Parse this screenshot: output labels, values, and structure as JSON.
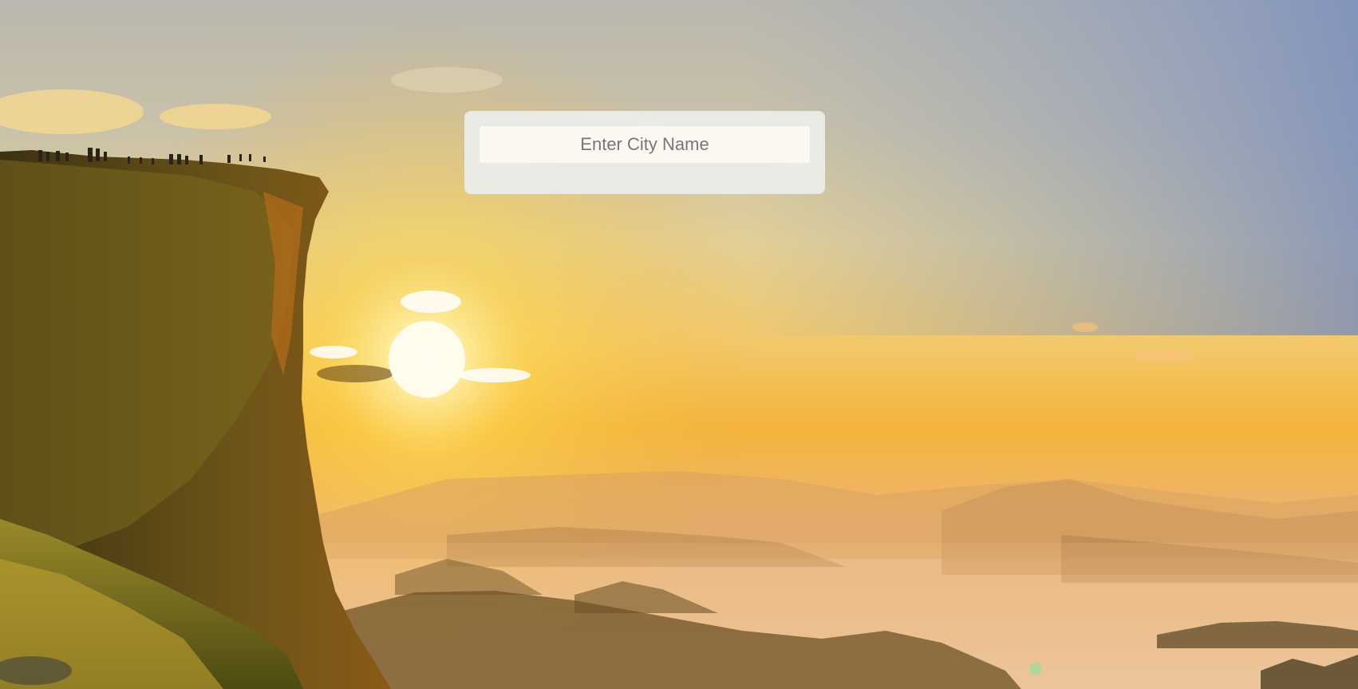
{
  "search": {
    "placeholder": "Enter City Name",
    "value": ""
  },
  "background": {
    "icon": "sunrise-mountain-cliff-image",
    "sky_top": "#b9b7ae",
    "sun_glow": "#fff6c8",
    "horizon": "#f4b43c",
    "cliff_dark": "#4a3a14"
  }
}
